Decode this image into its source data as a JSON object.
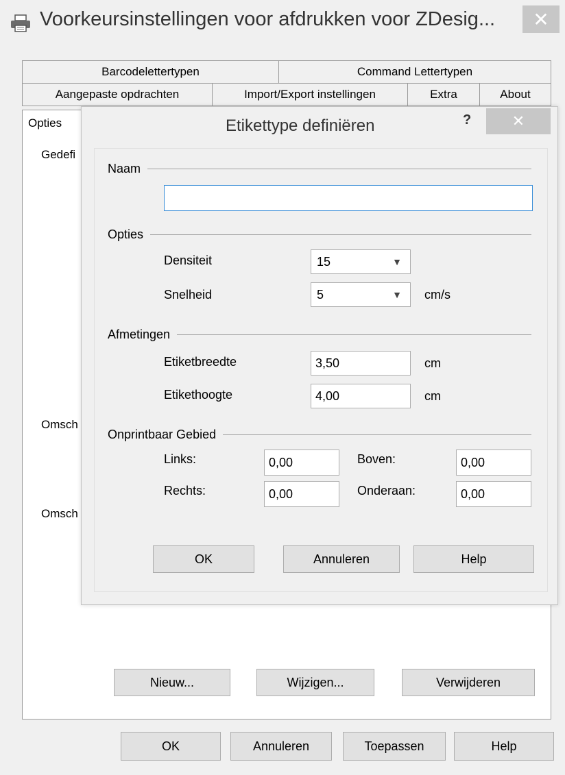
{
  "window": {
    "title": "Voorkeursinstellingen voor afdrukken voor ZDesig...",
    "close_glyph": "✕"
  },
  "tabs": {
    "row1": [
      "Barcodelettertypen",
      "Command Lettertypen"
    ],
    "row2": [
      "Aangepaste opdrachten",
      "Import/Export instellingen",
      "Extra",
      "About"
    ],
    "active": "Opties"
  },
  "background": {
    "label_defined": "Gedefi",
    "label_desc1": "Omsch",
    "label_desc2": "Omsch",
    "new_button": "Nieuw...",
    "edit_button": "Wijzigen...",
    "delete_button": "Verwijderen"
  },
  "bottom_buttons": {
    "ok": "OK",
    "cancel": "Annuleren",
    "apply": "Toepassen",
    "help": "Help"
  },
  "dialog": {
    "title": "Etikettype definiëren",
    "help_glyph": "?",
    "close_glyph": "✕",
    "name_section": "Naam",
    "name_value": "",
    "options_section": "Opties",
    "density_label": "Densiteit",
    "density_value": "15",
    "speed_label": "Snelheid",
    "speed_value": "5",
    "speed_unit": "cm/s",
    "dimensions_section": "Afmetingen",
    "width_label": "Etiketbreedte",
    "width_value": "3,50",
    "width_unit": "cm",
    "height_label": "Etikethoogte",
    "height_value": "4,00",
    "height_unit": "cm",
    "unprintable_section": "Onprintbaar Gebied",
    "left_label": "Links:",
    "left_value": "0,00",
    "top_label": "Boven:",
    "top_value": "0,00",
    "right_label": "Rechts:",
    "right_value": "0,00",
    "bottom_label": "Onderaan:",
    "bottom_value": "0,00",
    "ok": "OK",
    "cancel": "Annuleren",
    "help": "Help"
  }
}
